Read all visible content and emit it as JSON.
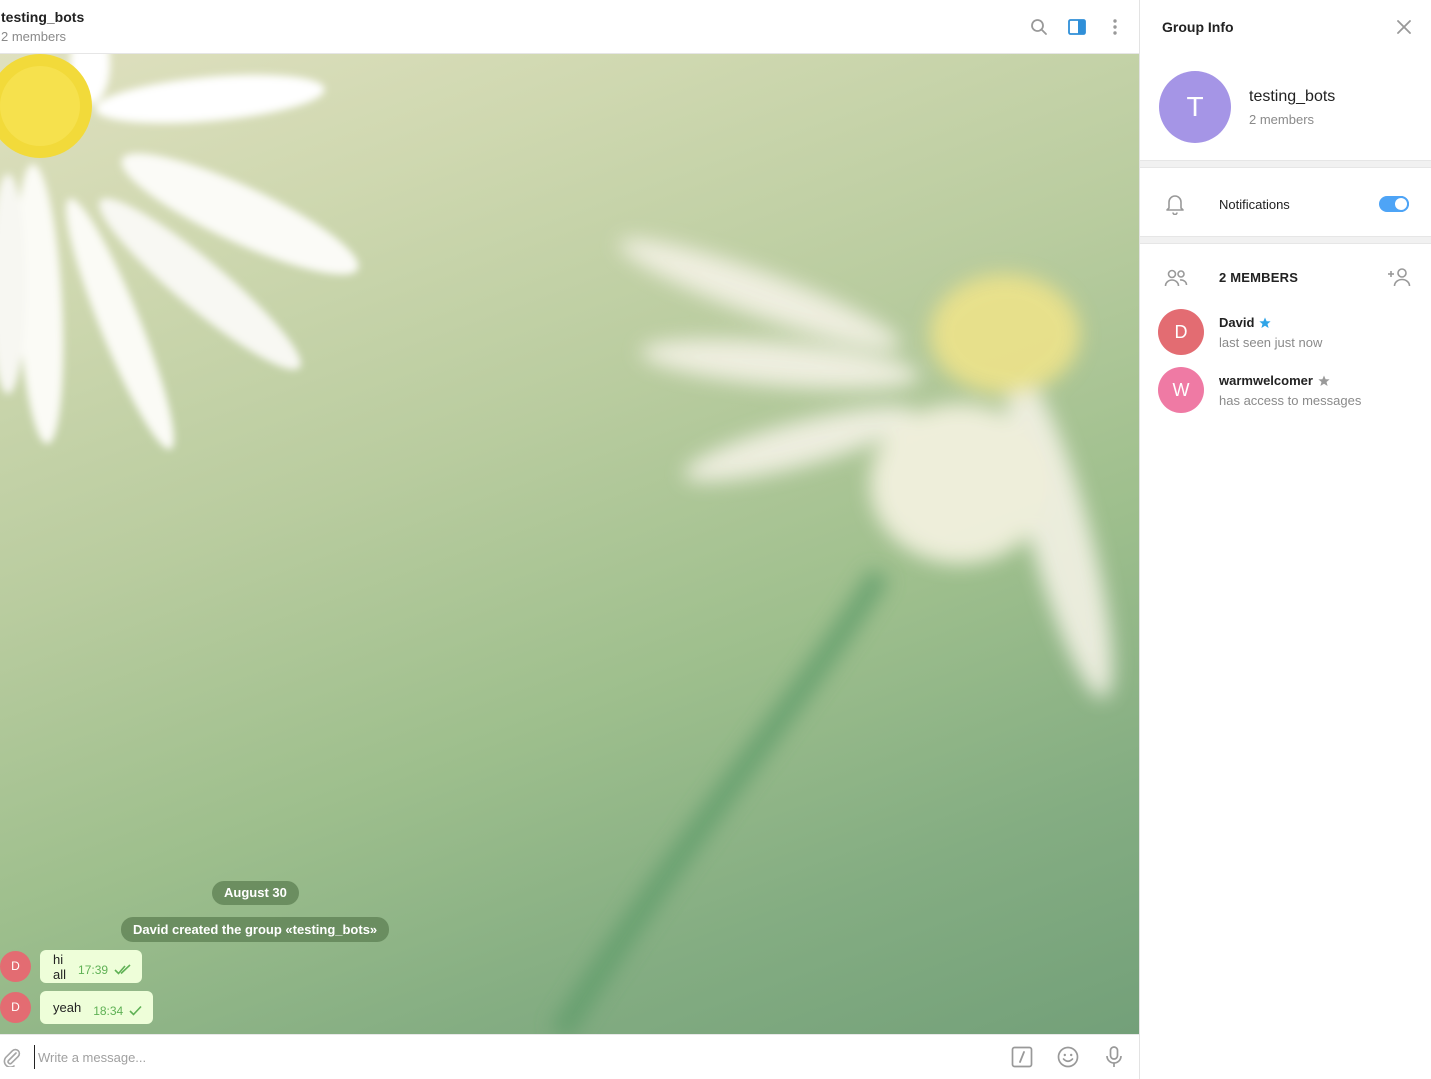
{
  "chat": {
    "title": "testing_bots",
    "subtitle": "2 members",
    "date_label": "August 30",
    "service_message": "David created the group «testing_bots»",
    "messages": [
      {
        "avatar": "D",
        "text": "hi all",
        "time": "17:39",
        "status": "read"
      },
      {
        "avatar": "D",
        "text": "yeah",
        "time": "18:34",
        "status": "sent"
      }
    ],
    "composer_placeholder": "Write a message..."
  },
  "header_icons": [
    "search-icon",
    "sidebar-toggle-icon",
    "more-vertical-icon"
  ],
  "composer_icons": [
    "paperclip-icon",
    "bot-command-icon",
    "emoji-icon",
    "microphone-icon"
  ],
  "panel": {
    "title": "Group Info",
    "group_initial": "T",
    "group_name": "testing_bots",
    "group_members": "2 members",
    "notifications_label": "Notifications",
    "notifications_on": true,
    "members_heading": "2 MEMBERS",
    "members": [
      {
        "initial": "D",
        "name": "David",
        "status": "last seen just now",
        "badge": "admin-star",
        "color": "#e36c72"
      },
      {
        "initial": "W",
        "name": "warmwelcomer",
        "status": "has access to messages",
        "badge": "bot-star",
        "color": "#ef7aa4"
      }
    ]
  },
  "colors": {
    "accent": "#4ea4f6",
    "bubble": "#eefed9",
    "check": "#5fb155",
    "group_avatar": "#a595e6"
  }
}
